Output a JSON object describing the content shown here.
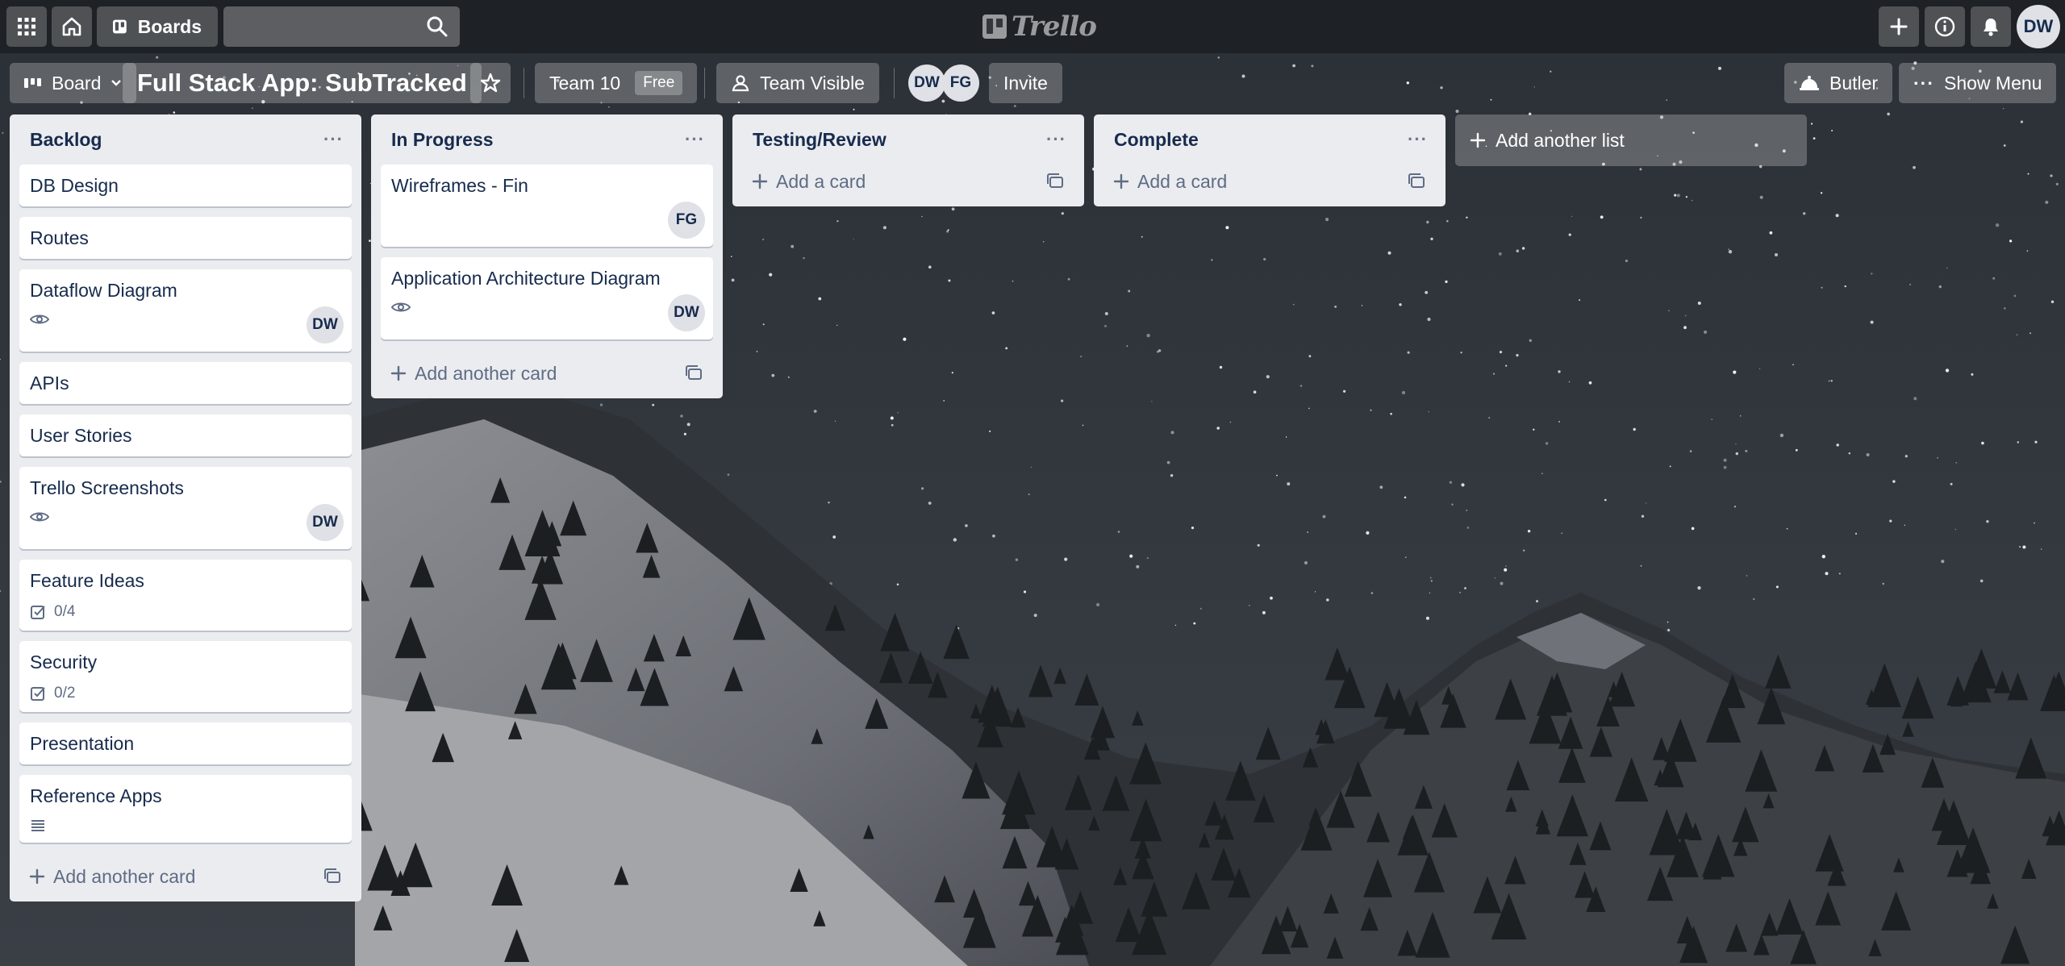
{
  "topbar": {
    "boards_label": "Boards",
    "search_value": "",
    "logo_text": "Trello",
    "user_initials": "DW"
  },
  "board_header": {
    "view_label": "Board",
    "title": "Full Stack App: SubTracked",
    "team_name": "Team 10",
    "team_plan": "Free",
    "visibility_label": "Team Visible",
    "members": [
      "DW",
      "FG"
    ],
    "invite_label": "Invite",
    "butler_label": "Butler",
    "show_menu_label": "Show Menu"
  },
  "lists": [
    {
      "name": "Backlog",
      "cards": [
        {
          "title": "DB Design"
        },
        {
          "title": "Routes"
        },
        {
          "title": "Dataflow Diagram",
          "badges": [
            "eye"
          ],
          "member": "DW"
        },
        {
          "title": "APIs"
        },
        {
          "title": "User Stories"
        },
        {
          "title": "Trello Screenshots",
          "badges": [
            "eye"
          ],
          "member": "DW"
        },
        {
          "title": "Feature Ideas",
          "checklist": "0/4"
        },
        {
          "title": "Security",
          "checklist": "0/2"
        },
        {
          "title": "Presentation"
        },
        {
          "title": "Reference Apps",
          "badges": [
            "description"
          ]
        }
      ],
      "add_label": "Add another card"
    },
    {
      "name": "In Progress",
      "cards": [
        {
          "title": "Wireframes - Fin",
          "member": "FG"
        },
        {
          "title": "Application Architecture Diagram",
          "badges": [
            "eye"
          ],
          "member": "DW"
        }
      ],
      "add_label": "Add another card"
    },
    {
      "name": "Testing/Review",
      "cards": [],
      "add_label": "Add a card"
    },
    {
      "name": "Complete",
      "cards": [],
      "add_label": "Add a card"
    }
  ],
  "add_list_label": "Add another list",
  "colors": {
    "list_bg": "#ebecf0",
    "text_primary": "#172b4d",
    "text_muted": "#5e6c84"
  }
}
